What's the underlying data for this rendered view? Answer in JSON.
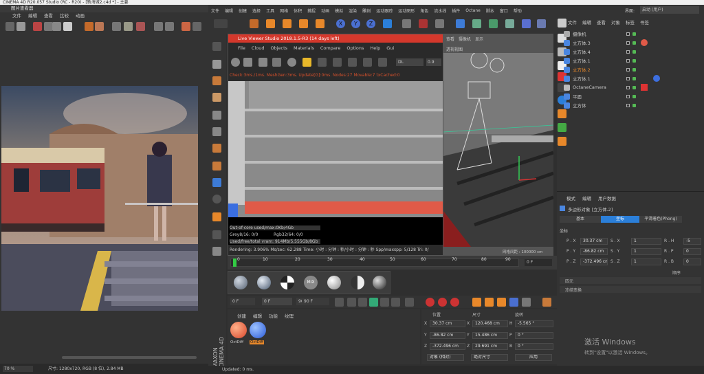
{
  "app": {
    "title": "CINEMA 4D R20.057 Studio (RC - R20) - [新海城2.c4d *] - 主要"
  },
  "picture_viewer": {
    "title": "图片查看器",
    "menu": [
      "文件",
      "编辑",
      "查看",
      "比较",
      "动画"
    ],
    "zoom": "70 %",
    "info": "尺寸: 1280x720, RGB (8 位), 2.84 MB"
  },
  "main_menu": [
    "文件",
    "编辑",
    "创建",
    "选择",
    "工具",
    "网格",
    "体积",
    "捕捉",
    "动画",
    "模拟",
    "渲染",
    "雕刻",
    "运动跟踪",
    "运动图形",
    "角色",
    "流水线",
    "插件",
    "Octane",
    "脚本",
    "窗口",
    "帮助"
  ],
  "layout": {
    "label": "界面:",
    "value": "启动 (用户)"
  },
  "coord_buttons": [
    "X",
    "Y",
    "Z"
  ],
  "live_viewer": {
    "title": "Live Viewer Studio 2018.1.5-R3 (14 days left)",
    "menu": [
      "File",
      "Cloud",
      "Objects",
      "Materials",
      "Compare",
      "Options",
      "Help",
      "Gui"
    ],
    "mode": "DL",
    "value": "0.9",
    "status": "Check:3ms./1ms. MeshGen:3ms. Update[G]:0ms. Nodes:27 Movable:7 txCached:0",
    "stats": [
      "Out-of-core used/max:0Kb/4Gb",
      "Grey8/16: 0/0",
      "Rgb32/64: 0/0",
      "Used/free/total vram: 914Mb/5.555Gb/8Gb"
    ],
    "rendering": "Rendering: 3.906%  Ms/sec: 62.288  Time: 小时 : 分钟 : 秒/小时 : 分钟 : 秒  Spp/maxspp: 5/128  Tri: 0/"
  },
  "viewport": {
    "label": "透视视图",
    "menu": [
      "查看",
      "摄像机",
      "显示"
    ],
    "grid": "网格间距 : 100000 cm"
  },
  "timeline": {
    "ticks": [
      "0",
      "10",
      "20",
      "30",
      "40",
      "50",
      "60",
      "70",
      "80",
      "90"
    ],
    "frame": "0 F",
    "start": "0 F",
    "start2": "0 F",
    "end": "90 F",
    "end2": "90 F"
  },
  "materials": {
    "menu": [
      "创建",
      "编辑",
      "功能",
      "纹理"
    ],
    "items": [
      "OctDiff",
      "OctDiff"
    ]
  },
  "coords": {
    "headers": [
      "位置",
      "尺寸",
      "旋转"
    ],
    "rows": [
      {
        "a": "X",
        "pos": "30.37 cm",
        "b": "X",
        "size": "120.468 cm",
        "c": "H",
        "rot": "-5.565 °"
      },
      {
        "a": "Y",
        "pos": "-86.82 cm",
        "b": "Y",
        "size": "15.486 cm",
        "c": "P",
        "rot": "0 °"
      },
      {
        "a": "Z",
        "pos": "-372.496 cm",
        "b": "Z",
        "size": "29.691 cm",
        "c": "B",
        "rot": "0 °"
      }
    ],
    "mode": "对象 (相对)",
    "size_mode": "绝对尺寸",
    "apply": "应用"
  },
  "object_manager": {
    "menu": [
      "文件",
      "编辑",
      "查看",
      "对象",
      "标签",
      "书签"
    ],
    "objects": [
      "摄像机",
      "立方体.3",
      "立方体.4",
      "立方体.1",
      "立方体.2",
      "立方体.1",
      "OctaneCamera",
      "平面",
      "立方体"
    ]
  },
  "attributes": {
    "menu": [
      "模式",
      "编辑",
      "用户数据"
    ],
    "title": "多边形对象 [立方体.2]",
    "tabs": [
      "基本",
      "坐标",
      "平滑着色(Phong)"
    ],
    "section": "坐标",
    "fields": [
      {
        "k": "P . X",
        "v": "30.37 cm",
        "s": "S . X",
        "sv": "1",
        "r": "R . H",
        "rv": "-5"
      },
      {
        "k": "P . Y",
        "v": "-86.82 cm",
        "s": "S . Y",
        "sv": "1",
        "r": "R . P",
        "rv": "0"
      },
      {
        "k": "P . Z",
        "v": "-372.496 cm",
        "s": "S . Z",
        "sv": "1",
        "r": "R . B",
        "rv": "0"
      }
    ],
    "order": "顺序",
    "quat": "四元",
    "freeze": "冻结变换"
  },
  "status": {
    "text": "Updated: 0 ms."
  },
  "watermark": {
    "line1": "激活 Windows",
    "line2": "转到\"设置\"以激活 Windows。"
  },
  "colors": {
    "accent": "#2b7fd9",
    "live_red": "#d4382c",
    "orange": "#e8882a"
  }
}
